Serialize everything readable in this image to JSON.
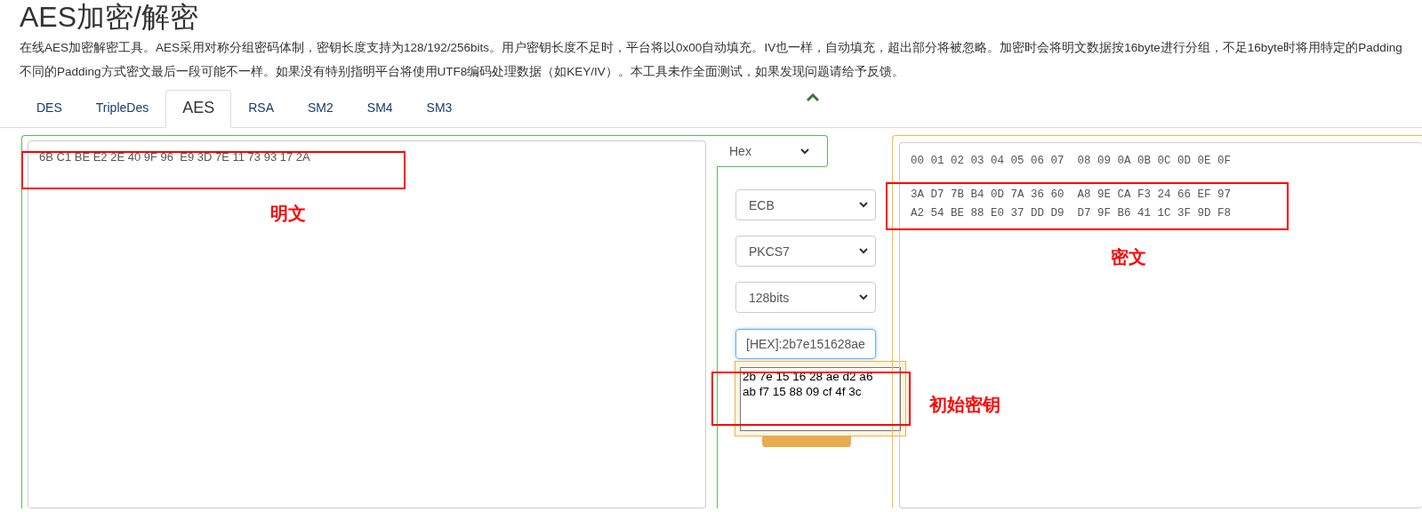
{
  "page": {
    "title": "AES加密/解密",
    "description_lines": [
      "在线AES加密解密工具。AES采用对称分组密码体制，密钥长度支持为128/192/256bits。用户密钥长度不足时，平台将以0x00自动填充。IV也一样，自动填充，超出部分将被忽略。加密时会将明文数据按16byte进行分组，不足16byte时将用特定的Padding",
      "不同的Padding方式密文最后一段可能不一样。如果没有特别指明平台将使用UTF8编码处理数据（如KEY/IV）。本工具未作全面测试，如果发现问题请给予反馈。"
    ]
  },
  "tabs": [
    {
      "label": "DES",
      "selected": false
    },
    {
      "label": "TripleDes",
      "selected": false
    },
    {
      "label": "AES",
      "selected": true
    },
    {
      "label": "RSA",
      "selected": false
    },
    {
      "label": "SM2",
      "selected": false
    },
    {
      "label": "SM4",
      "selected": false
    },
    {
      "label": "SM3",
      "selected": false
    }
  ],
  "plaintext": {
    "value": "6B C1 BE E2 2E 40 9F 96  E9 3D 7E 11 73 93 17 2A"
  },
  "encoding_select": {
    "value": "Hex"
  },
  "mode_select": {
    "value": "ECB"
  },
  "padding_select": {
    "value": "PKCS7"
  },
  "key_size_select": {
    "value": "128bits"
  },
  "key_input": {
    "value": "[HEX]:2b7e151628ae",
    "focused": true
  },
  "key_popup": {
    "lines": [
      "2b 7e 15 16 28 ae d2 a6",
      "ab f7 15 88 09 cf 4f 3c"
    ]
  },
  "ciphertext": {
    "header": "00 01 02 03 04 05 06 07  08 09 0A 0B 0C 0D 0E 0F",
    "rows": [
      "3A D7 7B B4 0D 7A 36 60  A8 9E CA F3 24 66 EF 97",
      "A2 54 BE 88 E0 37 DD D9  D7 9F B6 41 1C 3F 9D F8"
    ]
  },
  "annotations": [
    {
      "label": "明文"
    },
    {
      "label": "密文"
    },
    {
      "label": "初始密钥"
    }
  ]
}
